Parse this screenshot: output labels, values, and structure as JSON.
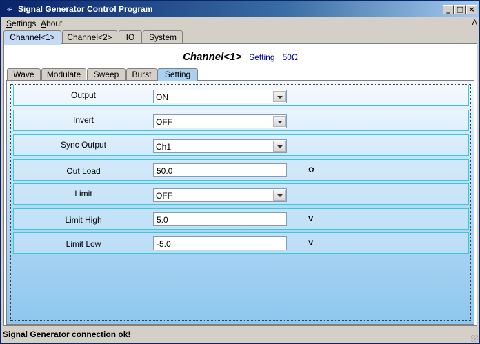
{
  "window": {
    "title": "Signal Generator Control Program",
    "app_icon": "waveform-icon",
    "controls": [
      "minimize",
      "maximize",
      "close"
    ]
  },
  "menu": {
    "items": [
      {
        "label": "Settings",
        "accel": "S",
        "rest": "ettings"
      },
      {
        "label": "About",
        "accel": "A",
        "rest": "bout"
      }
    ],
    "corner": "A"
  },
  "main_tabs": [
    {
      "label": "Channel<1>",
      "active": true
    },
    {
      "label": "Channel<2>",
      "active": false
    },
    {
      "label": "IO",
      "active": false
    },
    {
      "label": "System",
      "active": false
    }
  ],
  "channel_header": {
    "title": "Channel<1>",
    "mode": "Setting",
    "load": "50Ω"
  },
  "sub_tabs": [
    {
      "label": "Wave",
      "active": false
    },
    {
      "label": "Modulate",
      "active": false
    },
    {
      "label": "Sweep",
      "active": false
    },
    {
      "label": "Burst",
      "active": false
    },
    {
      "label": "Setting",
      "active": true
    }
  ],
  "settings": {
    "output": {
      "label": "Output",
      "value": "ON"
    },
    "invert": {
      "label": "Invert",
      "value": "OFF"
    },
    "sync_output": {
      "label": "Sync Output",
      "value": "Ch1"
    },
    "out_load": {
      "label": "Out Load",
      "value": "50.0",
      "unit": "Ω"
    },
    "limit": {
      "label": "Limit",
      "value": "OFF"
    },
    "limit_high": {
      "label": "Limit High",
      "value": "5.0",
      "unit": "V"
    },
    "limit_low": {
      "label": "Limit Low",
      "value": "-5.0",
      "unit": "V"
    }
  },
  "status": {
    "message": "Signal Generator connection ok!"
  },
  "colors": {
    "title_gradient_start": "#0a246a",
    "title_gradient_end": "#a6caf0",
    "row_border": "#39c8d8",
    "panel_gradient_bottom": "#8ec6ee",
    "header_accent": "#00009c"
  }
}
